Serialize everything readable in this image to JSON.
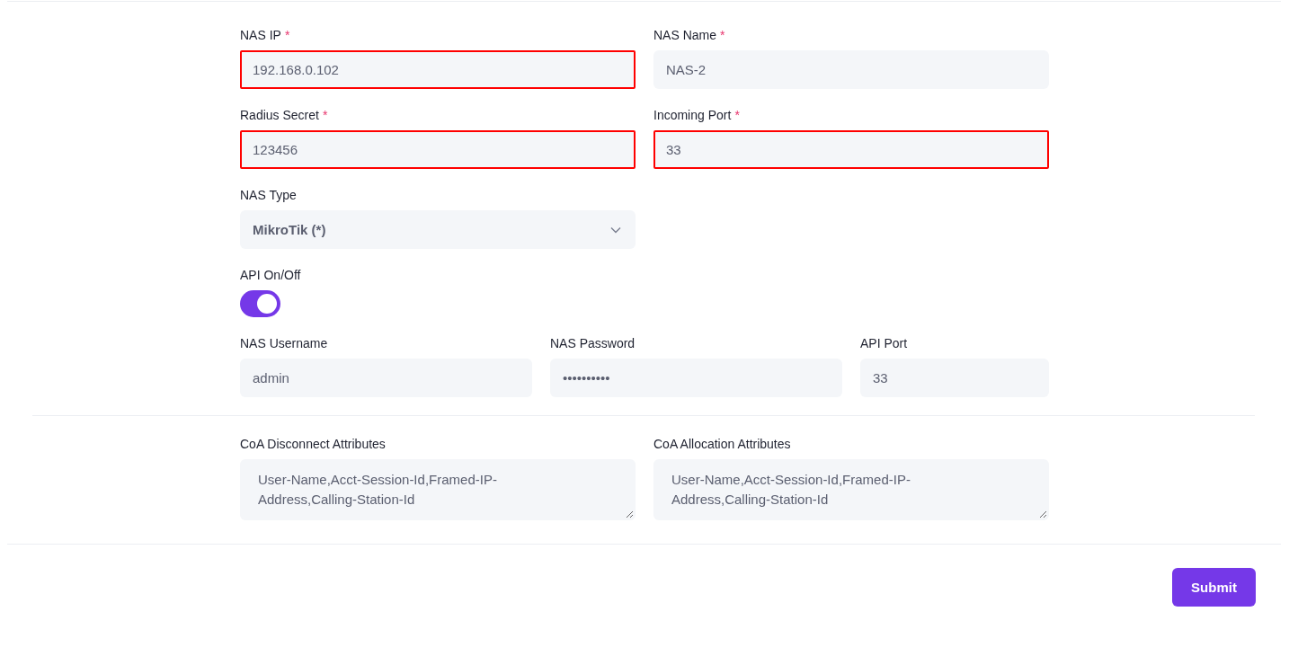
{
  "rows": [
    {
      "fields": [
        {
          "kind": "input",
          "label": "NAS IP",
          "required_mark": "*",
          "value": "192.168.0.102",
          "invalid": true
        },
        {
          "kind": "input",
          "label": "NAS Name",
          "required_mark": "*",
          "value": "NAS-2",
          "invalid": false
        }
      ]
    },
    {
      "fields": [
        {
          "kind": "input",
          "label": "Radius Secret",
          "required_mark": "*",
          "value": "123456",
          "invalid": true
        },
        {
          "kind": "input",
          "label": "Incoming Port",
          "required_mark": "*",
          "value": "33",
          "invalid": true
        }
      ]
    },
    {
      "fields": [
        {
          "kind": "select",
          "label": "NAS Type",
          "value": "MikroTik (*)",
          "invalid": false
        }
      ]
    },
    {
      "fields": [
        {
          "kind": "toggle",
          "label": "API On/Off",
          "on": true
        }
      ]
    },
    {
      "fields": [
        {
          "kind": "input",
          "label": "NAS Username",
          "value": "admin",
          "invalid": false
        },
        {
          "kind": "input",
          "label": "NAS Password",
          "value": "••••••••••",
          "invalid": false
        },
        {
          "kind": "input",
          "label": "API Port",
          "value": "33",
          "invalid": false
        }
      ]
    },
    {
      "kind": "divider"
    },
    {
      "fields": [
        {
          "kind": "textarea",
          "label": "CoA Disconnect Attributes",
          "value": "User-Name,Acct-Session-Id,Framed-IP-Address,Calling-Station-Id",
          "invalid": false
        },
        {
          "kind": "textarea",
          "label": "CoA Allocation Attributes",
          "value": "User-Name,Acct-Session-Id,Framed-IP-Address,Calling-Station-Id",
          "invalid": false
        }
      ]
    }
  ],
  "submit_button": "Submit"
}
